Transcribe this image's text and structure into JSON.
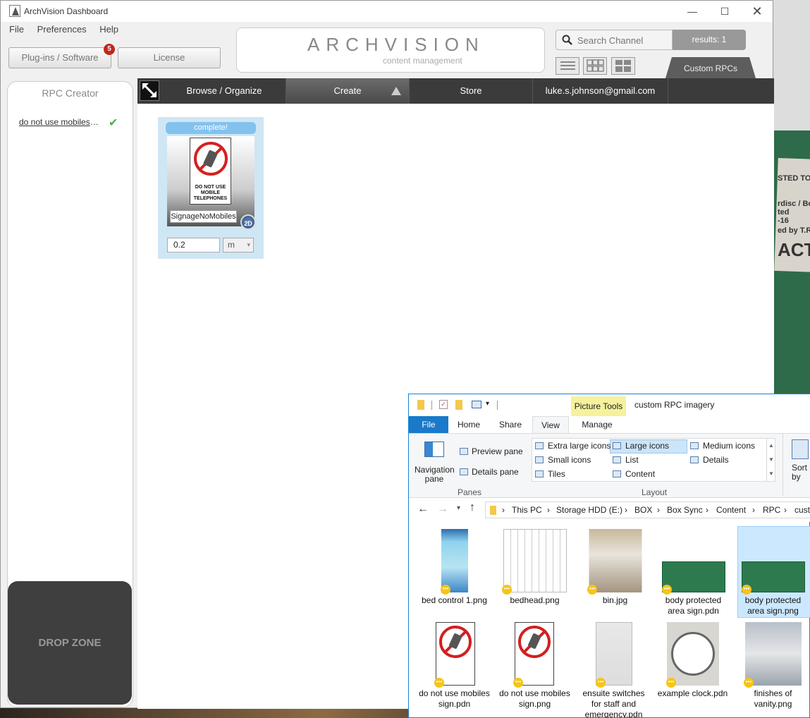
{
  "app": {
    "title": "ArchVision Dashboard",
    "menu": [
      "File",
      "Preferences",
      "Help"
    ],
    "plugins_label": "Plug-ins / Software",
    "plugins_badge": "5",
    "license_label": "License",
    "logo_text": "ARCHVISION",
    "logo_sub": "content management",
    "search_placeholder": "Search Channel",
    "results": "results: 1",
    "custom_tab": "Custom RPCs"
  },
  "nav": {
    "browse": "Browse / Organize",
    "create": "Create",
    "store": "Store",
    "user": "luke.s.johnson@gmail.com"
  },
  "panel": {
    "title": "RPC Creator",
    "item": "do not use mobiles s...",
    "drop_zone": "DROP ZONE"
  },
  "card": {
    "status": "complete!",
    "sign_text": "DO NOT USE MOBILE TELEPHONES",
    "name": "SignageNoMobiles",
    "badge": "2D",
    "size": "0.2",
    "unit": "m"
  },
  "desktop_note": [
    "STED TO",
    "rdisc / Bo",
    "ted",
    "-16",
    "ed by T.Ric",
    "ACTI"
  ],
  "explorer": {
    "context_tab": "Picture Tools",
    "title": "custom RPC imagery",
    "tabs": [
      "File",
      "Home",
      "Share",
      "View",
      "Manage"
    ],
    "nav_pane": "Navigation pane",
    "preview_pane": "Preview pane",
    "details_pane": "Details pane",
    "panes_group": "Panes",
    "layout_group": "Layout",
    "layouts": [
      "Extra large icons",
      "Large icons",
      "Medium icons",
      "Small icons",
      "List",
      "Details",
      "Tiles",
      "Content"
    ],
    "sort": "Sort by",
    "breadcrumb": [
      "This PC",
      "Storage HDD (E:)",
      "BOX",
      "Box Sync",
      "Content",
      "RPC",
      "cust"
    ],
    "files": [
      "bed control 1.png",
      "bedhead.png",
      "bin.jpg",
      "body protected area sign.pdn",
      "body protected area sign.png",
      "do not use mobiles sign.pdn",
      "do not use mobiles sign.png",
      "ensuite switches for staff and emergency.pdn",
      "example clock.pdn",
      "finishes of vanity.png"
    ]
  }
}
